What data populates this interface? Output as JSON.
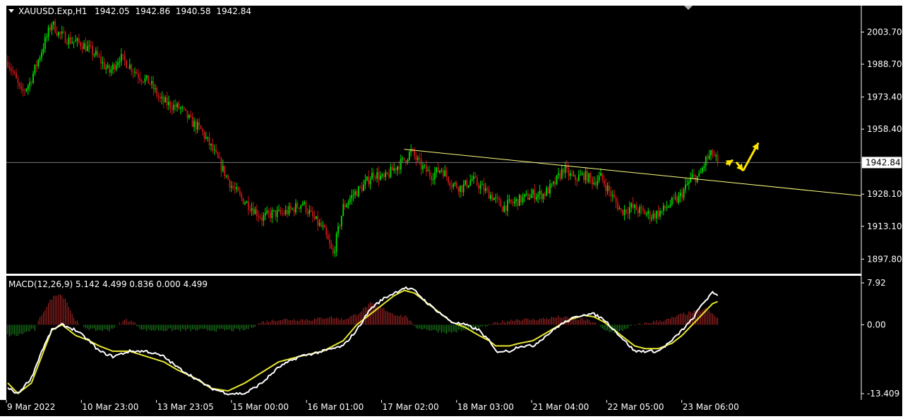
{
  "colors": {
    "background": "#000000",
    "foreground": "#ffffff",
    "bull": "#00e000",
    "bear": "#c81818",
    "trendline": "#ffff80",
    "arrow": "#ffe600",
    "macd_line": "#ffffff",
    "signal_line": "#e6e632",
    "hist_pos": "#b42828",
    "hist_neg": "#1e8c1e",
    "bid_line": "#787878"
  },
  "chart_data": [
    {
      "type": "candlestick",
      "symbol": "XAUUSD.Exp,H1",
      "ohlc_header": {
        "open": "1942.05",
        "high": "1942.86",
        "low": "1940.58",
        "close": "1942.84"
      },
      "y_ticks": [
        "2003.70",
        "1988.70",
        "1973.40",
        "1958.40",
        "1928.10",
        "1913.10",
        "1897.80"
      ],
      "current_price_label": "1942.84",
      "x_labels": [
        "9 Mar 2022",
        "10 Mar 23:00",
        "13 Mar 23:05",
        "15 Mar 00:00",
        "16 Mar 01:00",
        "17 Mar 02:00",
        "18 Mar 03:00",
        "21 Mar 04:00",
        "22 Mar 05:00",
        "23 Mar 06:00"
      ],
      "ylim": [
        1891,
        2016
      ],
      "grid": false,
      "close_path": [
        [
          0,
          1990
        ],
        [
          3,
          1985
        ],
        [
          8,
          1975
        ],
        [
          13,
          1980
        ],
        [
          20,
          1995
        ],
        [
          26,
          2008
        ],
        [
          30,
          2003
        ],
        [
          36,
          2000
        ],
        [
          44,
          1998
        ],
        [
          52,
          1993
        ],
        [
          60,
          1985
        ],
        [
          66,
          1992
        ],
        [
          72,
          1988
        ],
        [
          78,
          1983
        ],
        [
          84,
          1980
        ],
        [
          90,
          1972
        ],
        [
          95,
          1970
        ],
        [
          102,
          1968
        ],
        [
          108,
          1962
        ],
        [
          114,
          1958
        ],
        [
          120,
          1950
        ],
        [
          126,
          1941
        ],
        [
          132,
          1932
        ],
        [
          138,
          1926
        ],
        [
          144,
          1922
        ],
        [
          150,
          1917
        ],
        [
          156,
          1919
        ],
        [
          162,
          1919
        ],
        [
          168,
          1921
        ],
        [
          174,
          1924
        ],
        [
          180,
          1917
        ],
        [
          186,
          1912
        ],
        [
          192,
          1900
        ],
        [
          198,
          1922
        ],
        [
          204,
          1928
        ],
        [
          210,
          1932
        ],
        [
          216,
          1938
        ],
        [
          222,
          1935
        ],
        [
          228,
          1940
        ],
        [
          234,
          1944
        ],
        [
          238,
          1948
        ],
        [
          244,
          1941
        ],
        [
          250,
          1937
        ],
        [
          256,
          1940
        ],
        [
          262,
          1933
        ],
        [
          268,
          1931
        ],
        [
          274,
          1935
        ],
        [
          280,
          1931
        ],
        [
          286,
          1927
        ],
        [
          292,
          1922
        ],
        [
          298,
          1924
        ],
        [
          304,
          1926
        ],
        [
          310,
          1928
        ],
        [
          316,
          1928
        ],
        [
          322,
          1932
        ],
        [
          328,
          1940
        ],
        [
          334,
          1935
        ],
        [
          340,
          1937
        ],
        [
          346,
          1934
        ],
        [
          350,
          1936
        ],
        [
          356,
          1928
        ],
        [
          362,
          1920
        ],
        [
          368,
          1922
        ],
        [
          374,
          1920
        ],
        [
          380,
          1918
        ],
        [
          386,
          1920
        ],
        [
          390,
          1923
        ],
        [
          396,
          1926
        ],
        [
          400,
          1931
        ],
        [
          404,
          1936
        ],
        [
          408,
          1936
        ],
        [
          412,
          1944
        ],
        [
          416,
          1947
        ],
        [
          419,
          1943
        ]
      ],
      "trendline": [
        [
          234,
          1949
        ],
        [
          483,
          1929
        ]
      ],
      "arrows": [
        {
          "from": [
            424,
            1942
          ],
          "to": [
            428,
            1944
          ]
        },
        {
          "from": [
            430,
            1943
          ],
          "to": [
            434,
            1939
          ]
        },
        {
          "from": [
            434,
            1939
          ],
          "to": [
            443,
            1952
          ]
        }
      ]
    },
    {
      "type": "line",
      "indicator": "MACD(12,26,9) 5.142 4.499 0.836 0.000 4.499",
      "y_ticks": [
        "7.92",
        "0.00",
        "-13.409"
      ],
      "ylim": [
        -13.409,
        7.92
      ],
      "series": [
        {
          "values": [
            [
              0,
              -12
            ],
            [
              6,
              -13
            ],
            [
              14,
              -10
            ],
            [
              20,
              -5
            ],
            [
              26,
              -1
            ],
            [
              32,
              0
            ],
            [
              40,
              -1
            ],
            [
              48,
              -3
            ],
            [
              54,
              -5
            ],
            [
              62,
              -6
            ],
            [
              72,
              -5
            ],
            [
              82,
              -5
            ],
            [
              92,
              -6
            ],
            [
              100,
              -8
            ],
            [
              110,
              -10
            ],
            [
              120,
              -12
            ],
            [
              130,
              -13
            ],
            [
              140,
              -13
            ],
            [
              150,
              -11
            ],
            [
              160,
              -8
            ],
            [
              172,
              -6
            ],
            [
              186,
              -5
            ],
            [
              198,
              -4
            ],
            [
              206,
              -1
            ],
            [
              214,
              3
            ],
            [
              222,
              5
            ],
            [
              228,
              6
            ],
            [
              234,
              7
            ],
            [
              240,
              6.5
            ],
            [
              248,
              4
            ],
            [
              256,
              2
            ],
            [
              262,
              0.5
            ],
            [
              270,
              0
            ],
            [
              278,
              -1
            ],
            [
              284,
              -3
            ],
            [
              288,
              -5
            ],
            [
              296,
              -5
            ],
            [
              302,
              -4
            ],
            [
              310,
              -4
            ],
            [
              318,
              -2
            ],
            [
              326,
              0
            ],
            [
              332,
              1
            ],
            [
              340,
              2
            ],
            [
              346,
              2
            ],
            [
              352,
              1
            ],
            [
              358,
              -1
            ],
            [
              364,
              -3
            ],
            [
              370,
              -5
            ],
            [
              376,
              -5
            ],
            [
              384,
              -5
            ],
            [
              392,
              -3
            ],
            [
              398,
              -1
            ],
            [
              404,
              1
            ],
            [
              410,
              4
            ],
            [
              416,
              6
            ],
            [
              420,
              5.5
            ]
          ]
        },
        {
          "values": [
            [
              0,
              -11
            ],
            [
              6,
              -13
            ],
            [
              14,
              -11
            ],
            [
              20,
              -6
            ],
            [
              26,
              -1
            ],
            [
              32,
              0
            ],
            [
              40,
              -2
            ],
            [
              48,
              -3
            ],
            [
              54,
              -4
            ],
            [
              62,
              -5
            ],
            [
              72,
              -5
            ],
            [
              82,
              -6
            ],
            [
              92,
              -7
            ],
            [
              100,
              -8.5
            ],
            [
              110,
              -10
            ],
            [
              120,
              -12
            ],
            [
              130,
              -12.5
            ],
            [
              140,
              -11
            ],
            [
              150,
              -9
            ],
            [
              160,
              -7
            ],
            [
              172,
              -6
            ],
            [
              186,
              -5
            ],
            [
              198,
              -3
            ],
            [
              206,
              0
            ],
            [
              214,
              2
            ],
            [
              222,
              4
            ],
            [
              228,
              5.5
            ],
            [
              234,
              6.5
            ],
            [
              240,
              6
            ],
            [
              248,
              4
            ],
            [
              256,
              2
            ],
            [
              262,
              0.5
            ],
            [
              270,
              -0.5
            ],
            [
              278,
              -2
            ],
            [
              284,
              -3
            ],
            [
              288,
              -4
            ],
            [
              296,
              -4
            ],
            [
              302,
              -3.5
            ],
            [
              310,
              -3
            ],
            [
              318,
              -1.5
            ],
            [
              326,
              0
            ],
            [
              332,
              1
            ],
            [
              340,
              1.8
            ],
            [
              346,
              1.5
            ],
            [
              352,
              0.5
            ],
            [
              358,
              -1
            ],
            [
              364,
              -2.5
            ],
            [
              370,
              -4
            ],
            [
              376,
              -4.5
            ],
            [
              384,
              -4.5
            ],
            [
              392,
              -3.5
            ],
            [
              398,
              -2
            ],
            [
              404,
              0
            ],
            [
              410,
              2
            ],
            [
              416,
              4
            ],
            [
              420,
              4.5
            ]
          ]
        },
        {
          "values": [
            [
              0,
              -2
            ],
            [
              6,
              -2
            ],
            [
              14,
              -1
            ],
            [
              16,
              -1
            ],
            [
              20,
              2
            ],
            [
              26,
              5
            ],
            [
              30,
              6
            ],
            [
              34,
              5
            ],
            [
              38,
              2
            ],
            [
              42,
              0
            ],
            [
              50,
              -1
            ],
            [
              60,
              -1
            ],
            [
              70,
              1
            ],
            [
              74,
              0.5
            ],
            [
              80,
              -1
            ],
            [
              90,
              -1
            ],
            [
              100,
              -1
            ],
            [
              110,
              -1
            ],
            [
              120,
              -1
            ],
            [
              130,
              -1
            ],
            [
              140,
              -1
            ],
            [
              150,
              0.5
            ],
            [
              160,
              1
            ],
            [
              170,
              1
            ],
            [
              180,
              1
            ],
            [
              190,
              1.5
            ],
            [
              198,
              1
            ],
            [
              206,
              2
            ],
            [
              214,
              4
            ],
            [
              222,
              3
            ],
            [
              228,
              2
            ],
            [
              236,
              1.5
            ],
            [
              240,
              -0.5
            ],
            [
              250,
              -1
            ],
            [
              260,
              -1.5
            ],
            [
              270,
              -1
            ],
            [
              280,
              -0.5
            ],
            [
              290,
              0.5
            ],
            [
              300,
              1
            ],
            [
              310,
              1
            ],
            [
              318,
              1.2
            ],
            [
              326,
              1.5
            ],
            [
              332,
              1.2
            ],
            [
              340,
              1
            ],
            [
              346,
              0.5
            ],
            [
              352,
              -1
            ],
            [
              360,
              -1.5
            ],
            [
              366,
              -0.5
            ],
            [
              372,
              0
            ],
            [
              380,
              0.5
            ],
            [
              390,
              1
            ],
            [
              398,
              2
            ],
            [
              406,
              2.5
            ],
            [
              412,
              3
            ],
            [
              420,
              1
            ]
          ]
        }
      ]
    }
  ]
}
